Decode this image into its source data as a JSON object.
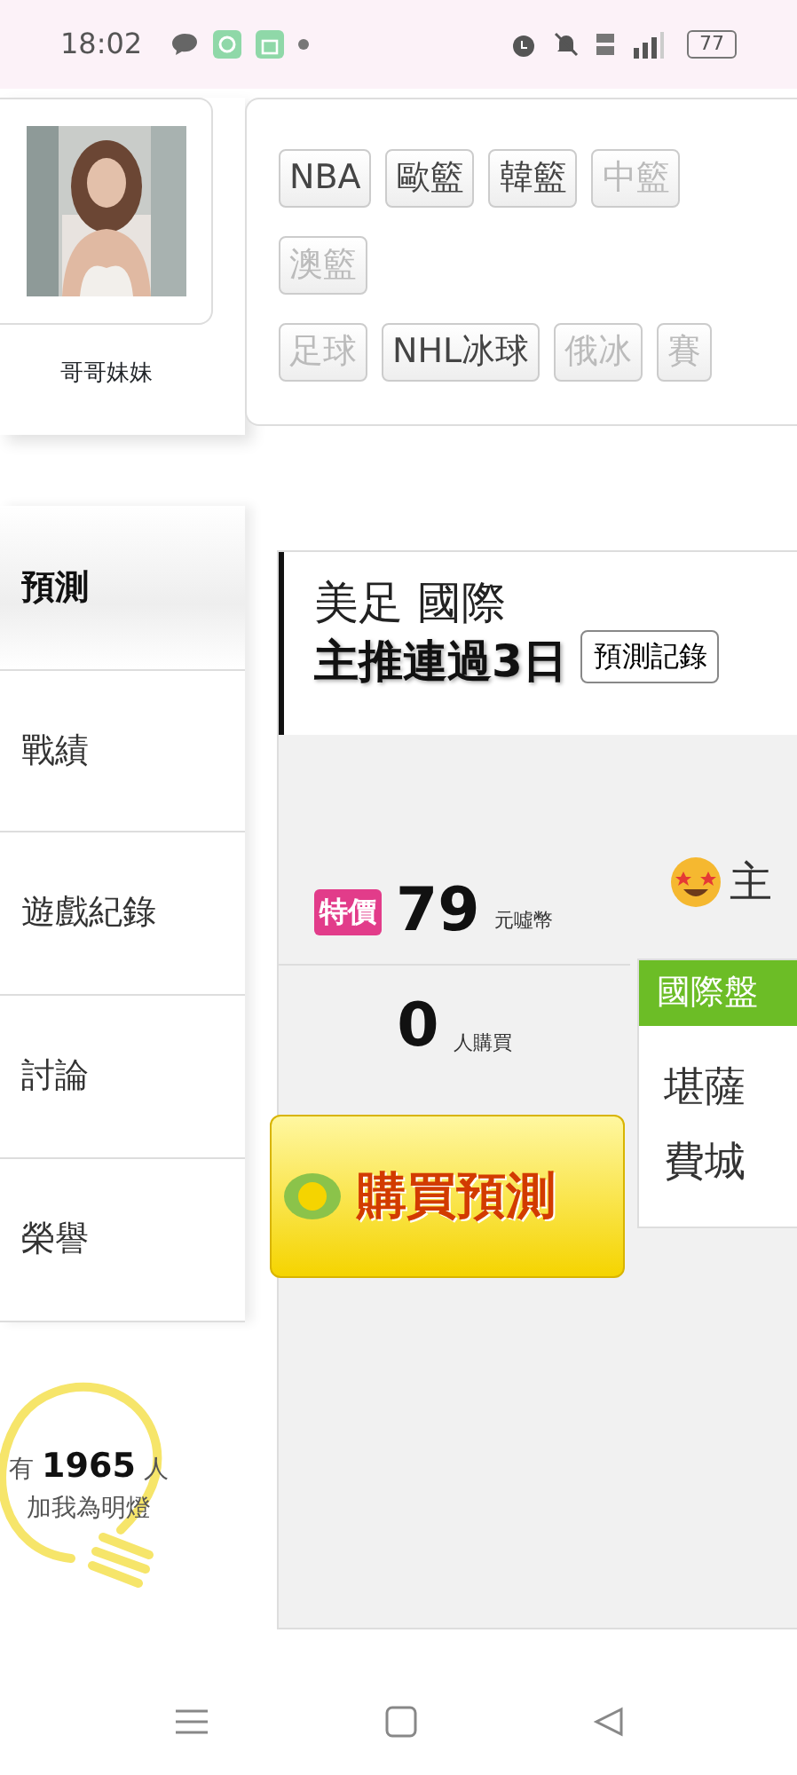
{
  "status_bar": {
    "time": "18:02",
    "battery": "77"
  },
  "profile": {
    "name": "哥哥妹妹"
  },
  "tag_rows": [
    [
      {
        "label": "NBA",
        "disabled": false
      },
      {
        "label": "歐籃",
        "disabled": false
      },
      {
        "label": "韓籃",
        "disabled": false
      },
      {
        "label": "中籃",
        "disabled": true
      }
    ],
    [
      {
        "label": "澳籃",
        "disabled": true
      }
    ],
    [
      {
        "label": "足球",
        "disabled": true
      },
      {
        "label": "NHL冰球",
        "disabled": false
      },
      {
        "label": "俄冰",
        "disabled": true
      },
      {
        "label": "賽",
        "disabled": true
      }
    ]
  ],
  "menu": [
    {
      "label": "預測",
      "selected": true
    },
    {
      "label": "戰績",
      "selected": false
    },
    {
      "label": "遊戲紀錄",
      "selected": false
    },
    {
      "label": "討論",
      "selected": false
    },
    {
      "label": "榮譽",
      "selected": false
    }
  ],
  "fans": {
    "prefix": "有",
    "count": "1965",
    "suffix": "人",
    "caption": "加我為明燈"
  },
  "prediction": {
    "title": "美足 國際",
    "subtitle": "主推連過3日",
    "record_button": "預測記錄",
    "price_badge": "特價",
    "price": "79",
    "price_unit": "元噓幣",
    "buyers": "0",
    "buyers_unit": "人購買",
    "buy_button": "購買預測",
    "pick": "主",
    "panel_title": "國際盤",
    "teams": [
      "堪薩",
      "費城"
    ]
  }
}
